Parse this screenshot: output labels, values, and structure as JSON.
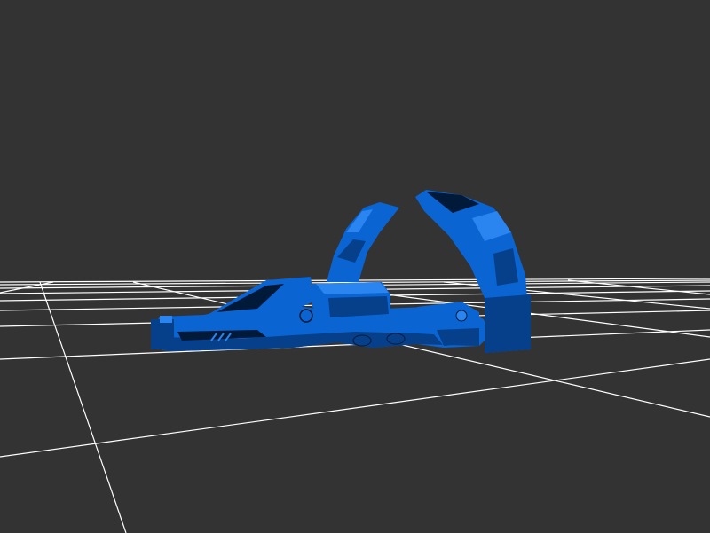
{
  "viewport": {
    "background_color": "#333333",
    "grid_color": "#ffffff",
    "model_color": "#0a64d2",
    "model_shadow_color": "#063f8a",
    "model_dark_color": "#021a3a",
    "model_highlight_color": "#2a85f0"
  }
}
